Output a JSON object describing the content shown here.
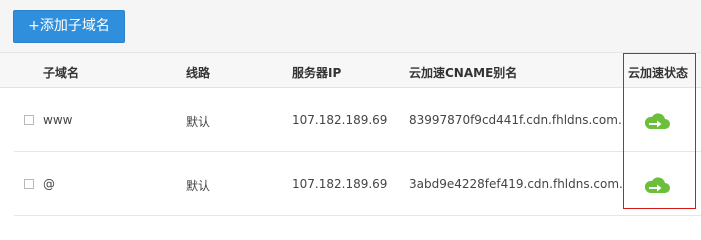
{
  "toolbar": {
    "add_subdomain_label": "+添加子域名"
  },
  "table": {
    "headers": {
      "subdomain": "子域名",
      "line": "线路",
      "server_ip": "服务器IP",
      "cname": "云加速CNAME别名",
      "status": "云加速状态"
    },
    "rows": [
      {
        "subdomain": "www",
        "line": "默认",
        "server_ip": "107.182.189.69",
        "cname": "83997870f9cd441f.cdn.fhldns.com.",
        "status_icon": "cloud-arrow-icon"
      },
      {
        "subdomain": "@",
        "line": "默认",
        "server_ip": "107.182.189.69",
        "cname": "3abd9e4228fef419.cdn.fhldns.com.",
        "status_icon": "cloud-arrow-icon"
      }
    ]
  },
  "colors": {
    "button": "#2f8fdc",
    "cloud_icon": "#6cbf3b",
    "highlight_border": "#d7191c"
  }
}
